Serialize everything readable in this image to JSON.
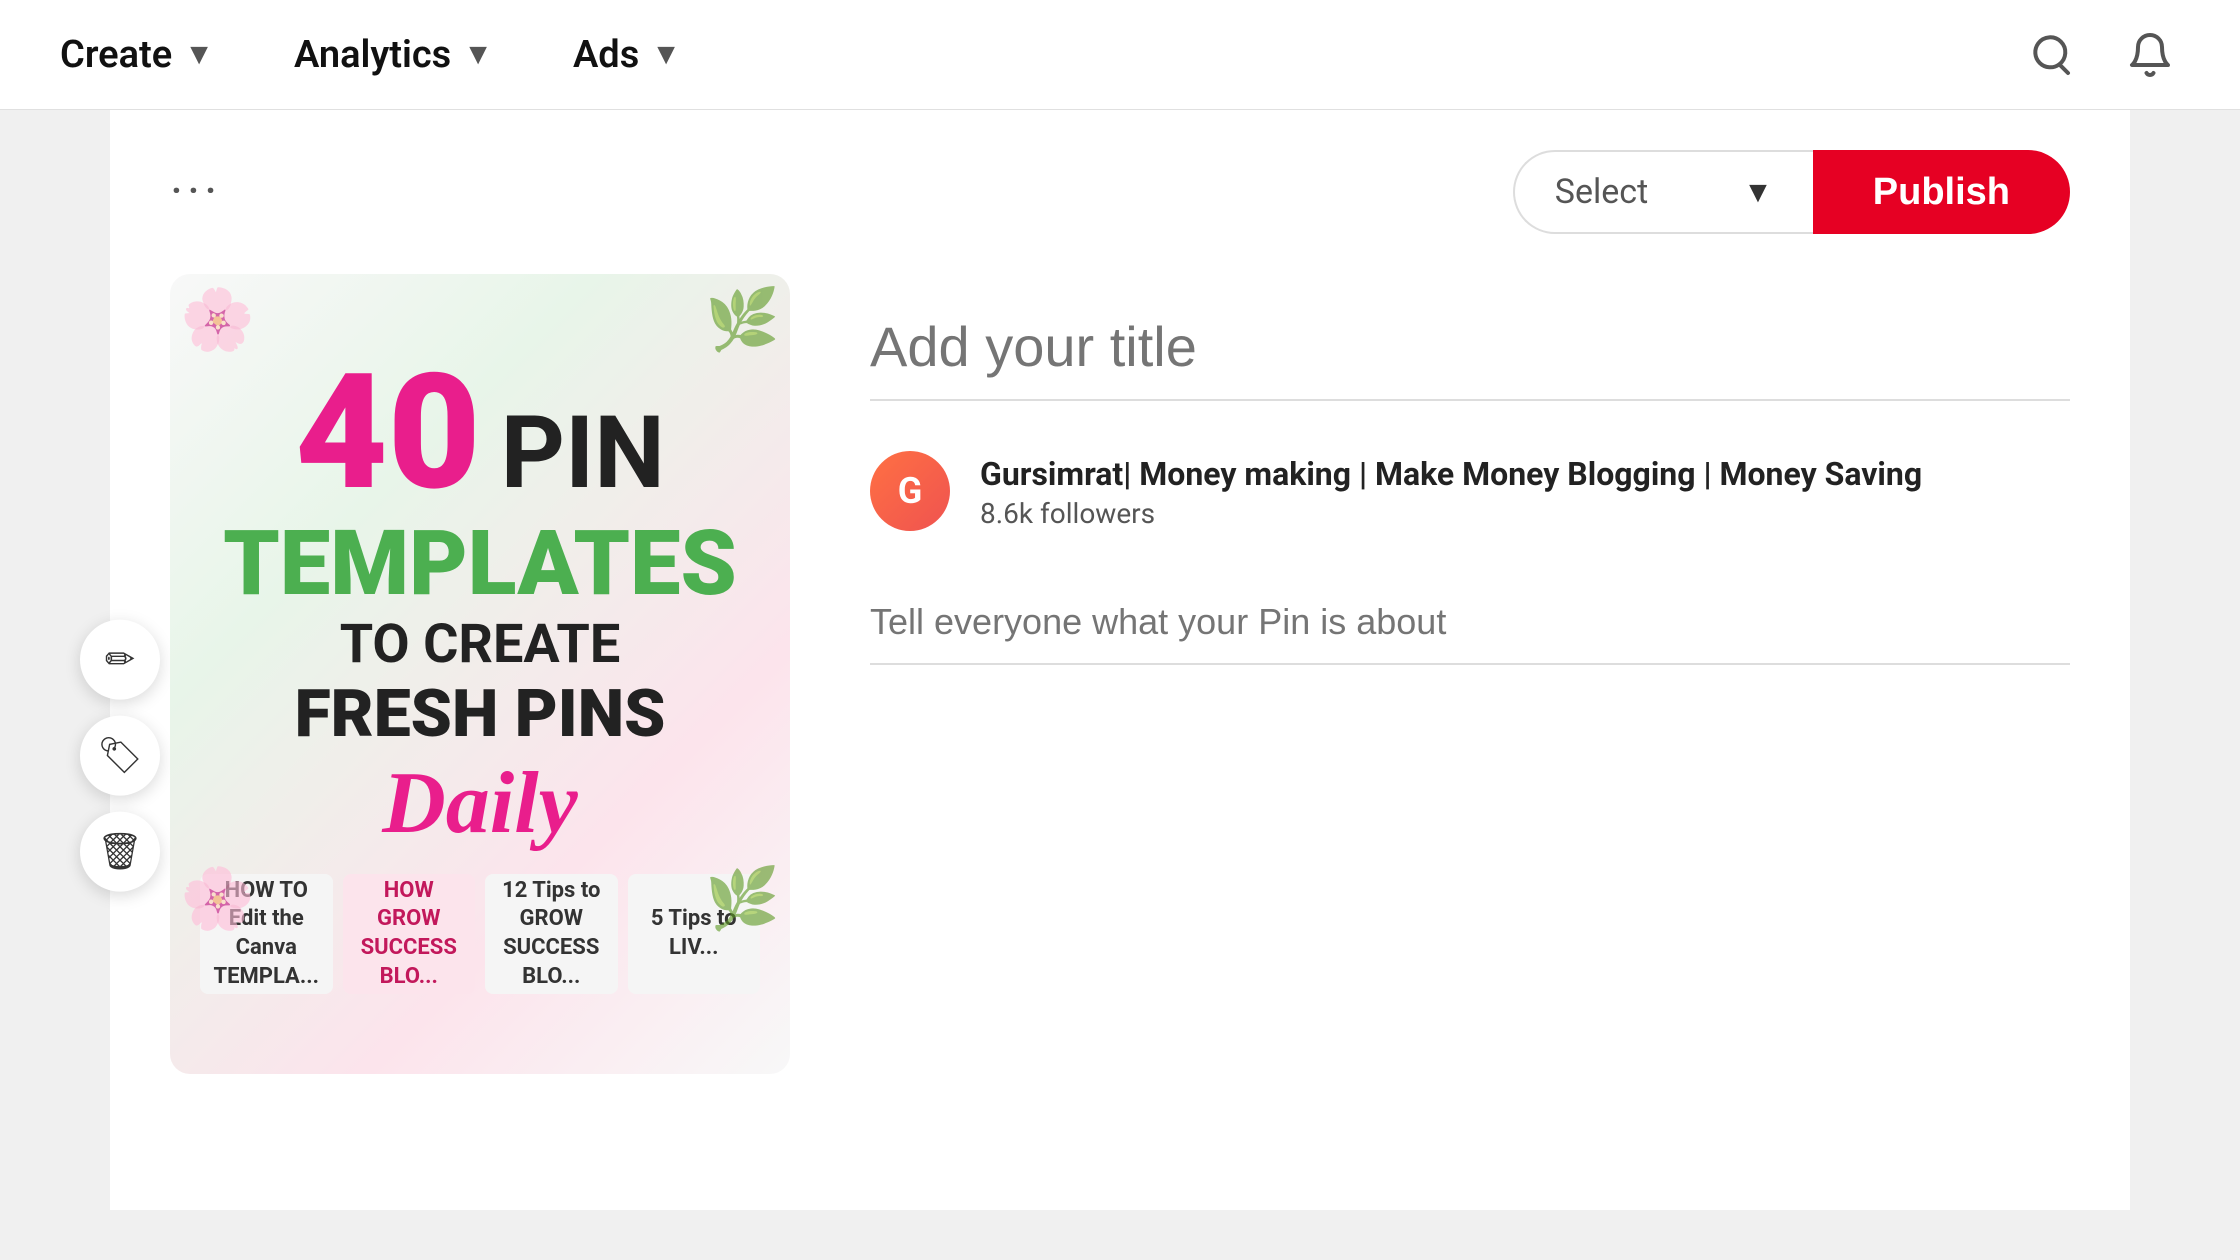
{
  "header": {
    "nav": [
      {
        "label": "Create",
        "id": "create"
      },
      {
        "label": "Analytics",
        "id": "analytics"
      },
      {
        "label": "Ads",
        "id": "ads"
      }
    ],
    "searchLabel": "search",
    "notificationLabel": "notifications"
  },
  "toolbar": {
    "dots": "···",
    "select_label": "Select",
    "select_placeholder": "Select",
    "publish_label": "Publish"
  },
  "pin": {
    "number": "40",
    "pin_text": "PIN",
    "templates_text": "TEMPLATES",
    "to_create_text": "TO CREATE",
    "fresh_pins_text": "FRESH PINS",
    "daily_text": "Daily",
    "cards": [
      {
        "text": "HOW TO Edit the Canva TEMPLA...",
        "type": "white"
      },
      {
        "text": "HOW GROW SUCCESS BLO...",
        "type": "pink"
      },
      {
        "text": "12 Tips to GROW SUCCESS BLO...",
        "type": "white"
      },
      {
        "text": "5 Tips to LIV...",
        "type": "white"
      }
    ]
  },
  "actions": [
    {
      "icon": "✏",
      "label": "edit-icon"
    },
    {
      "icon": "🏷",
      "label": "tag-icon"
    },
    {
      "icon": "🗑",
      "label": "delete-icon"
    }
  ],
  "form": {
    "title_placeholder": "Add your title",
    "account_name": "Gursimrat| Money making | Make Money Blogging | Money Saving",
    "followers": "8.6k followers",
    "description_placeholder": "Tell everyone what your Pin is about"
  }
}
